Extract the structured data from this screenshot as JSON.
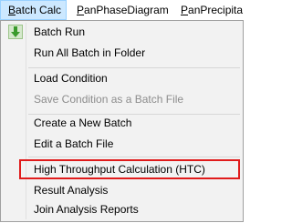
{
  "menubar": {
    "items": [
      {
        "mnemonic": "B",
        "rest": "atch Calc"
      },
      {
        "mnemonic": "P",
        "rest": "anPhaseDiagram"
      },
      {
        "mnemonic": "P",
        "rest": "anPrecipita"
      }
    ]
  },
  "menu": {
    "items": [
      {
        "label": "Batch Run",
        "icon": "green-down-arrow-icon",
        "enabled": true
      },
      {
        "label": "Run All Batch in Folder",
        "enabled": true
      },
      {
        "label": "Load Condition",
        "enabled": true
      },
      {
        "label": "Save Condition as a Batch File",
        "enabled": false
      },
      {
        "label": "Create a New Batch",
        "enabled": true
      },
      {
        "label": "Edit a Batch File",
        "enabled": true
      },
      {
        "label": "High Throughput Calculation (HTC)",
        "enabled": true,
        "highlighted": true
      },
      {
        "label": "Result Analysis",
        "enabled": true
      },
      {
        "label": "Join Analysis Reports",
        "enabled": true
      }
    ]
  },
  "colors": {
    "highlight_border": "#e01b1b",
    "active_menu_bg": "#cce8ff",
    "icon_green": "#3a9a2c"
  }
}
